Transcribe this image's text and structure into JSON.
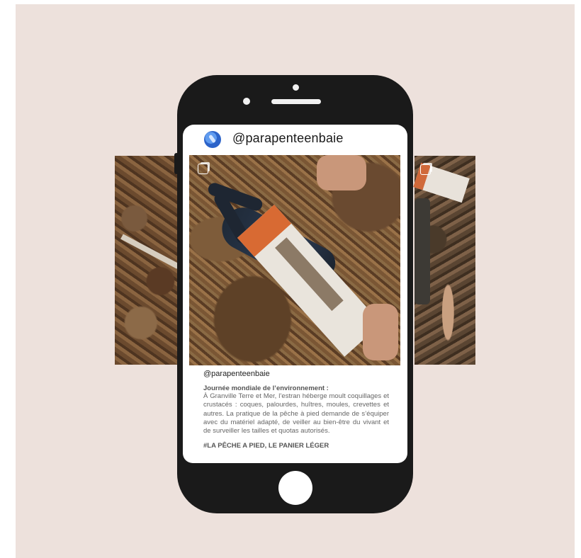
{
  "post": {
    "username": "@parapenteenbaie",
    "caption_username": "@parapenteenbaie",
    "caption_title": "Journée mondiale de l’environnement :",
    "caption_body": "À Granville Terre et Mer, l’estran héberge moult coquillages et crustacés : coques, palourdes, huîtres, moules, crevettes et autres. La pratique de la pêche à pied demande de s’équiper avec du matériel adapté, de veiller au bien-être du vivant et de surveiller les tailles et quotas autorisés.",
    "hashtags": "#LA PÊCHE A PIED, LE PANIER LÉGER"
  },
  "icons": {
    "avatar": "paraglider-avatar",
    "carousel": "carousel-icon"
  },
  "colors": {
    "background": "#ede1dc",
    "phone_frame": "#1a1a1a",
    "avatar_blue": "#2c63c9"
  }
}
